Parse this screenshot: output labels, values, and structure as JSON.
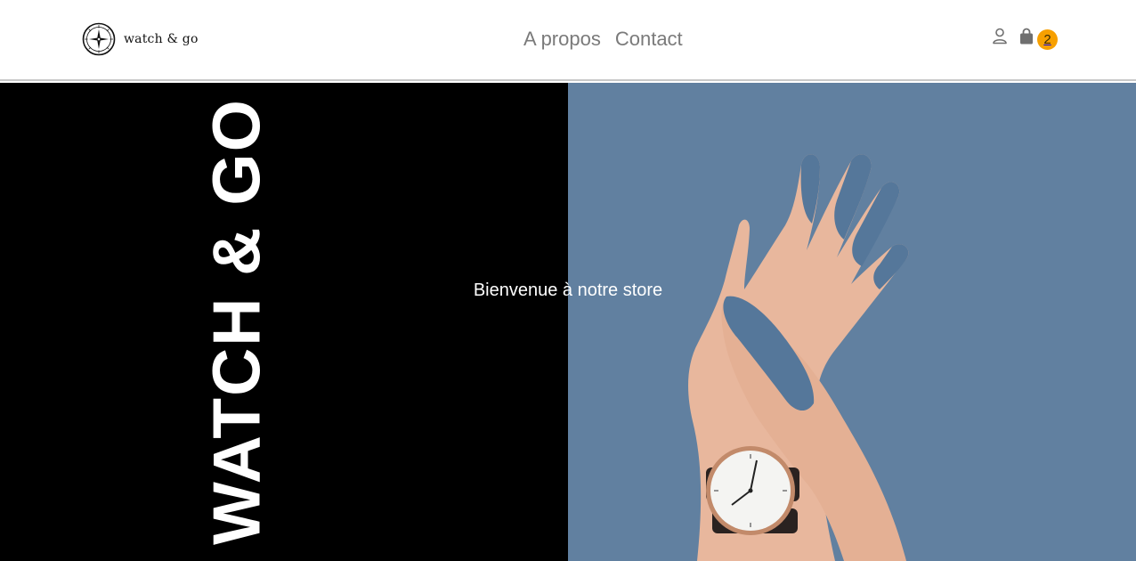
{
  "header": {
    "logo": {
      "text": "watch & go",
      "icon": "compass-logo-icon"
    },
    "nav": [
      {
        "label": "A propos"
      },
      {
        "label": "Contact"
      }
    ],
    "user_icon": "user-icon",
    "cart": {
      "icon": "shopping-bag-icon",
      "count": "2",
      "badge_color": "#f7a000"
    }
  },
  "hero": {
    "brand_vertical": "WATCH & GO",
    "welcome": "Bienvenue à notre store",
    "colors": {
      "left_panel": "#000000",
      "right_panel": "#6180a0"
    }
  }
}
